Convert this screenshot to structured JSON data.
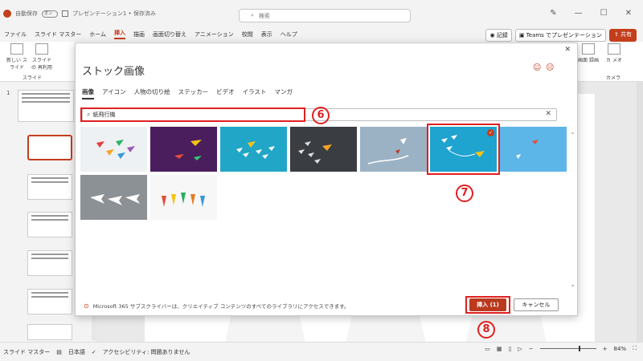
{
  "titlebar": {
    "autosave_label": "自動保存",
    "autosave_state": "オン",
    "doc_title": "プレゼンテーション1 • 保存済み",
    "search_placeholder": "検索"
  },
  "menu": {
    "items": [
      "ファイル",
      "スライド マスター",
      "ホーム",
      "挿入",
      "描画",
      "画面切り替え",
      "アニメーション",
      "校閲",
      "表示",
      "ヘルプ"
    ],
    "active": "挿入",
    "record": "記録",
    "teams": "Teams でプレゼンテーション",
    "share": "共有"
  },
  "ribbon": {
    "new_slide": "新しい スライド",
    "reuse_slide": "スライドの 再利用",
    "group_slides": "スライド",
    "screen_recording": "画面 録画",
    "camera": "カ メオ",
    "group_camera": "カメラ"
  },
  "slide_pane": {
    "first_number": "1"
  },
  "statusbar": {
    "mode": "スライド マスター",
    "language": "日本語",
    "accessibility": "アクセシビリティ: 問題ありません",
    "zoom": "84%"
  },
  "dialog": {
    "title": "ストック画像",
    "tabs": [
      "画像",
      "アイコン",
      "人物の切り絵",
      "ステッカー",
      "ビデオ",
      "イラスト",
      "マンガ"
    ],
    "active_tab": "画像",
    "search_value": "紙飛行機",
    "footer_note": "Microsoft 365 サブスクライバーは、クリエイティブ コンテンツのすべてのライブラリにアクセスできます。",
    "insert_label": "挿入 (1)",
    "cancel_label": "キャンセル",
    "selected_image_index": 5
  },
  "annotations": {
    "step6": "6",
    "step7": "7",
    "step8": "8"
  },
  "colors": {
    "accent": "#c43e1c",
    "highlight": "#e02020"
  }
}
